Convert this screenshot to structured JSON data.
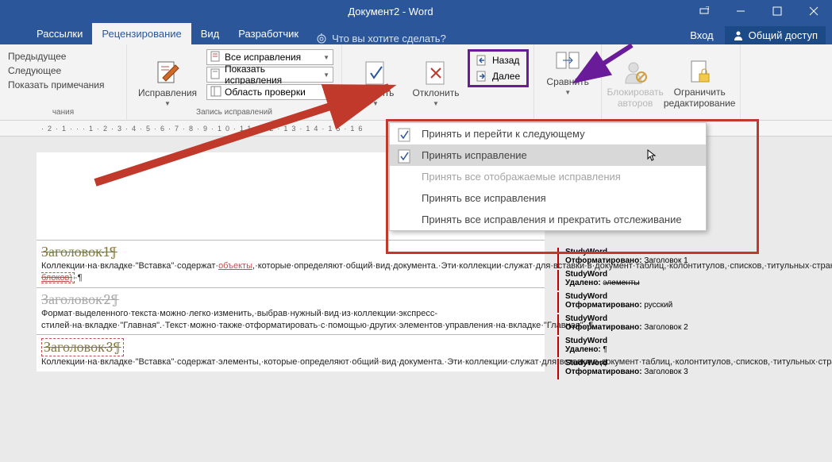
{
  "titlebar": {
    "title": "Документ2 - Word"
  },
  "tabs": {
    "items": [
      "Рассылки",
      "Рецензирование",
      "Вид",
      "Разработчик"
    ],
    "active": 1,
    "tell_me": "Что вы хотите сделать?"
  },
  "right": {
    "sign_in": "Вход",
    "share": "Общий доступ"
  },
  "ribbon": {
    "col0": {
      "prev": "Предыдущее",
      "next": "Следующее",
      "show_notes": "Показать примечания",
      "group": "чания"
    },
    "tracking_group": {
      "big": "Исправления",
      "combo": "Все исправления",
      "show_markup": "Показать исправления",
      "review_pane": "Область проверки",
      "label": "Запись исправлений"
    },
    "changes_group": {
      "accept": "Принять",
      "reject": "Отклонить",
      "back": "Назад",
      "next": "Далее"
    },
    "compare": {
      "label": "Сравнить"
    },
    "protect": {
      "block": "Блокировать авторов",
      "restrict": "Ограничить редактирование"
    }
  },
  "accept_menu": {
    "items": [
      "Принять и перейти к следующему",
      "Принять исправление",
      "Принять все отображаемые исправления",
      "Принять все исправления",
      "Принять все исправления и прекратить отслеживание"
    ]
  },
  "document": {
    "h1": "Заголовок·1¶",
    "p1": "Коллекции·на·вкладке·\"Вставка\"·содержат·объекты,·которые·определяют·общий·вид·документа.·Эти·коллекции·служат·для·вставки·в·документ·таблиц,·колонтитулов,·списков,·титульных·страниц·(обложек)·и·других·стандартных·блоков.·(экспресс-блоков)·¶",
    "h2": "Заголовок·2¶",
    "p2": "Формат·выделенного·текста·можно·легко·изменить,·выбрав·нужный·вид·из·коллекции·экспресс-стилей·на·вкладке·\"Главная\".·Текст·можно·также·отформатировать·с·помощью·других·элементов·управления·на·вкладке·\"Главная\".·¶",
    "h3": "Заголовок·3¶",
    "p3": "Коллекции·на·вкладке·\"Вставка\"·содержат·элементы,·которые·определяют·общий·вид·документа.·Эти·коллекции·служат·для·вставки·в·документ·таблиц,·колонтитулов,·списков,·титульных·страниц·и·других·стандартных·блоков.¶"
  },
  "markup": [
    {
      "author": "StudyWord",
      "action": "Отформатировано:",
      "value": "Заголовок 1"
    },
    {
      "author": "StudyWord",
      "action": "Удалено:",
      "value": "элементы"
    },
    {
      "author": "StudyWord",
      "action": "Отформатировано:",
      "value": "русский"
    },
    {
      "author": "StudyWord",
      "action": "Отформатировано:",
      "value": "Заголовок 2"
    },
    {
      "author": "StudyWord",
      "action": "Удалено:",
      "value": "¶"
    },
    {
      "author": "StudyWord",
      "action": "Отформатировано:",
      "value": "Заголовок 3"
    }
  ],
  "ruler_text": "·2·1···1·2·3·4·5·6·7·8·9·10·11·12·13·14·15·16"
}
